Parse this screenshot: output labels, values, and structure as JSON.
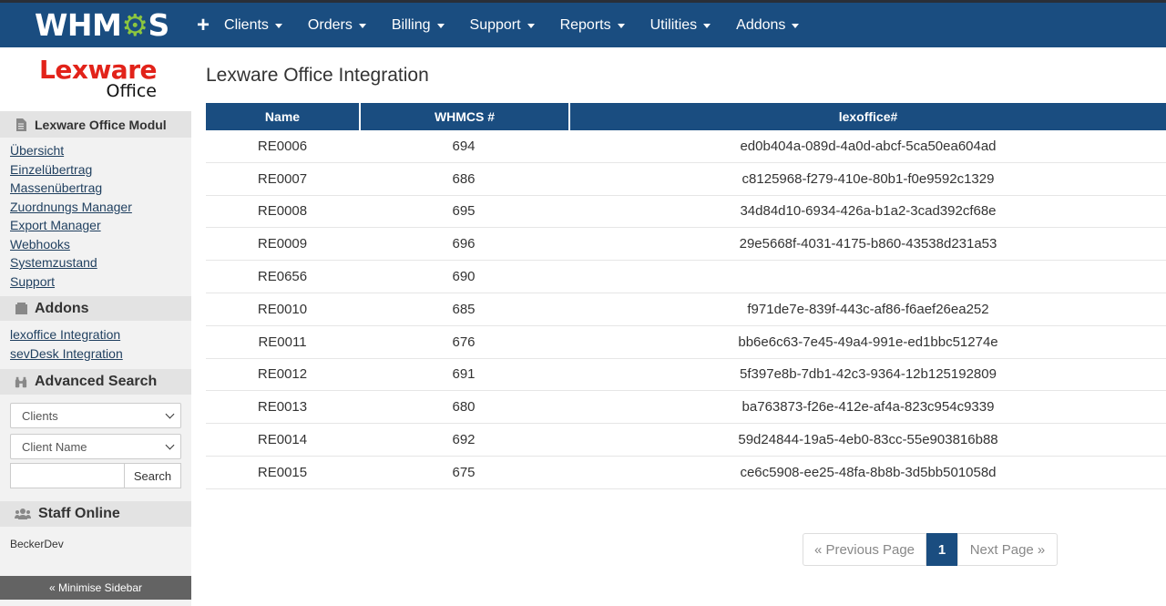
{
  "topnav": {
    "logo_text": "WHMCS",
    "items": [
      {
        "label": "Clients"
      },
      {
        "label": "Orders"
      },
      {
        "label": "Billing"
      },
      {
        "label": "Support"
      },
      {
        "label": "Reports"
      },
      {
        "label": "Utilities"
      },
      {
        "label": "Addons"
      }
    ]
  },
  "sidebar": {
    "brand": {
      "line1": "Lexware",
      "line2": "Office"
    },
    "module_heading": "Lexware Office Modul",
    "module_links": [
      "Übersicht",
      "Einzelübertrag",
      "Massenübertrag",
      "Zuordnungs Manager",
      "Export Manager",
      "Webhooks",
      "Systemzustand",
      "Support"
    ],
    "addons_heading": "Addons",
    "addons_links": [
      "lexoffice Integration",
      "sevDesk Integration"
    ],
    "search_heading": "Advanced Search",
    "search_type": "Clients",
    "search_field": "Client Name",
    "search_button": "Search",
    "staff_heading": "Staff Online",
    "staff_user": "BeckerDev",
    "minimise_label": "« Minimise Sidebar"
  },
  "main": {
    "title": "Lexware Office Integration",
    "table": {
      "headers": [
        "Name",
        "WHMCS #",
        "lexoffice#"
      ],
      "rows": [
        [
          "RE0006",
          "694",
          "ed0b404a-089d-4a0d-abcf-5ca50ea604ad"
        ],
        [
          "RE0007",
          "686",
          "c8125968-f279-410e-80b1-f0e9592c1329"
        ],
        [
          "RE0008",
          "695",
          "34d84d10-6934-426a-b1a2-3cad392cf68e"
        ],
        [
          "RE0009",
          "696",
          "29e5668f-4031-4175-b860-43538d231a53"
        ],
        [
          "RE0656",
          "690",
          ""
        ],
        [
          "RE0010",
          "685",
          "f971de7e-839f-443c-af86-f6aef26ea252"
        ],
        [
          "RE0011",
          "676",
          "bb6e6c63-7e45-49a4-991e-ed1bbc51274e"
        ],
        [
          "RE0012",
          "691",
          "5f397e8b-7db1-42c3-9364-12b125192809"
        ],
        [
          "RE0013",
          "680",
          "ba763873-f26e-412e-af4a-823c954c9339"
        ],
        [
          "RE0014",
          "692",
          "59d24844-19a5-4eb0-83cc-55e903816b88"
        ],
        [
          "RE0015",
          "675",
          "ce6c5908-ee25-48fa-8b8b-3d5bb501058d"
        ]
      ]
    },
    "pager": {
      "prev": "« Previous Page",
      "current": "1",
      "next": "Next Page »"
    }
  }
}
